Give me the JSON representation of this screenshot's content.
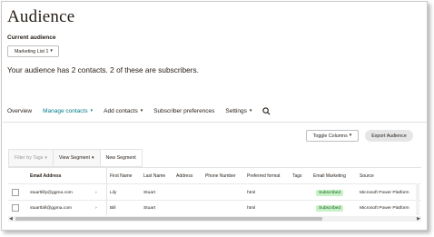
{
  "page": {
    "title": "Audience",
    "current_label": "Current audience",
    "list_select": "Marketing List 1",
    "summary": "Your audience has 2 contacts. 2 of these are subscribers."
  },
  "nav": {
    "overview": "Overview",
    "manage": "Manage contacts",
    "add": "Add contacts",
    "prefs": "Subscriber preferences",
    "settings": "Settings"
  },
  "actions": {
    "toggle_columns": "Toggle Columns",
    "export": "Export Audience"
  },
  "toolbar": {
    "filter": "Filter by Tags",
    "view_segment": "View Segment",
    "new_segment": "New Segment"
  },
  "table": {
    "headers": {
      "email": "Email Address",
      "first": "First Name",
      "last": "Last Name",
      "address": "Address",
      "phone": "Phone Number",
      "format": "Preferred format",
      "tags": "Tags",
      "marketing": "Email Marketing",
      "source": "Source"
    },
    "rows": [
      {
        "email": "stuartlilly@ggma.com",
        "first": "Lily",
        "last": "Stuart",
        "format": "html",
        "marketing": "Subscribed",
        "source": "Microsoft Power Platform"
      },
      {
        "email": "stuartbill@ggma.com",
        "first": "Bill",
        "last": "Stuart",
        "format": "html",
        "marketing": "Subscribed",
        "source": "Microsoft Power Platform"
      }
    ]
  },
  "colors": {
    "accent": "#007c89",
    "badge_bg": "#c7f2c7",
    "text": "#241c15"
  }
}
